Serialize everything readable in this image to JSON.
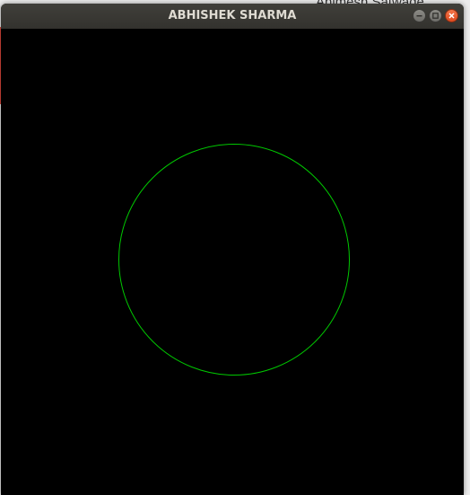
{
  "window": {
    "title": "ABHISHEK SHARMA",
    "buttons": {
      "minimize": "minimize-icon",
      "maximize": "maximize-icon",
      "close": "close-icon"
    }
  },
  "background_app": {
    "partial_heading": "Animesh Satwade"
  },
  "canvas": {
    "background": "#000000",
    "shape": "circle",
    "stroke_color": "#00c800"
  },
  "colors": {
    "titlebar": "#3a3935",
    "close_button": "#e8582c"
  }
}
